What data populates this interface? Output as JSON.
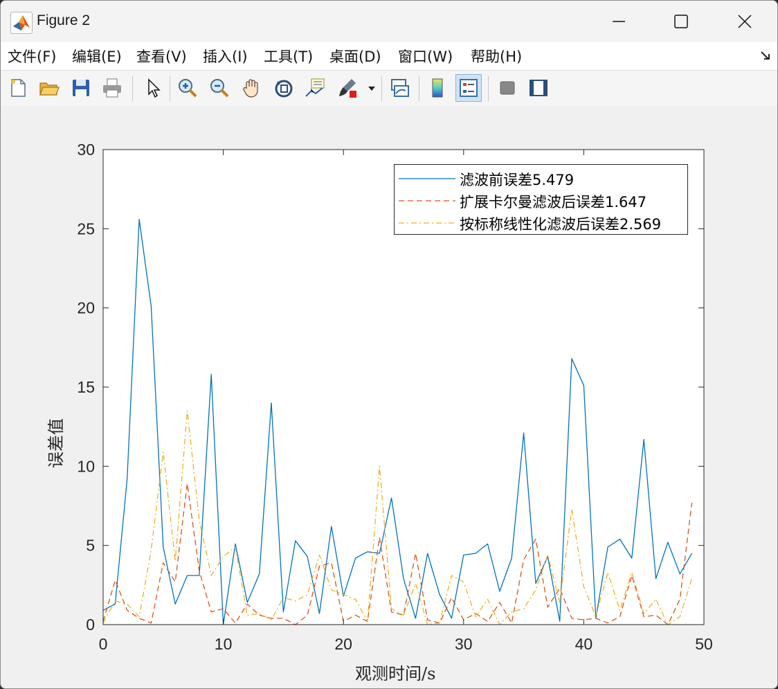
{
  "window": {
    "title": "Figure 2"
  },
  "menu": {
    "items": [
      {
        "label": "文件(F)"
      },
      {
        "label": "编辑(E)"
      },
      {
        "label": "查看(V)"
      },
      {
        "label": "插入(I)"
      },
      {
        "label": "工具(T)"
      },
      {
        "label": "桌面(D)"
      },
      {
        "label": "窗口(W)"
      },
      {
        "label": "帮助(H)"
      }
    ]
  },
  "toolbar": {
    "icons": [
      "new-figure-icon",
      "open-folder-icon",
      "save-icon",
      "print-icon",
      "pointer-icon",
      "zoom-in-icon",
      "zoom-out-icon",
      "pan-hand-icon",
      "rotate-3d-icon",
      "data-cursor-icon",
      "brush-icon",
      "dropdown-arrow-icon",
      "link-plot-icon",
      "colorbar-icon",
      "legend-icon",
      "hide-plot-tools-icon",
      "show-plot-tools-icon"
    ]
  },
  "colors": {
    "series1": "#0072BD",
    "series2": "#D95319",
    "series3": "#EDB120",
    "axes": "#262626",
    "plot_bg": "#ffffff"
  },
  "chart_data": {
    "type": "line",
    "title": "",
    "xlabel": "观测时间/s",
    "ylabel": "误差值",
    "xlim": [
      0,
      50
    ],
    "ylim": [
      0,
      30
    ],
    "xticks": [
      0,
      10,
      20,
      30,
      40,
      50
    ],
    "yticks": [
      0,
      5,
      10,
      15,
      20,
      25,
      30
    ],
    "grid": false,
    "legend_position": "top-right",
    "x": [
      0,
      1,
      2,
      3,
      4,
      5,
      6,
      7,
      8,
      9,
      10,
      11,
      12,
      13,
      14,
      15,
      16,
      17,
      18,
      19,
      20,
      21,
      22,
      23,
      24,
      25,
      26,
      27,
      28,
      29,
      30,
      31,
      32,
      33,
      34,
      35,
      36,
      37,
      38,
      39,
      40,
      41,
      42,
      43,
      44,
      45,
      46,
      47,
      48,
      49
    ],
    "series": [
      {
        "name": "滤波前误差5.479",
        "style": "solid",
        "values": [
          0.9,
          1.3,
          9.2,
          25.6,
          20.1,
          4.9,
          1.3,
          3.1,
          3.1,
          15.8,
          0.0,
          5.1,
          1.4,
          3.2,
          14.0,
          0.8,
          5.3,
          4.3,
          0.7,
          6.2,
          1.8,
          4.2,
          4.6,
          4.5,
          8.0,
          2.9,
          0.4,
          4.5,
          1.9,
          0.4,
          4.4,
          4.5,
          5.1,
          2.1,
          4.2,
          12.1,
          2.6,
          4.3,
          0.2,
          16.8,
          15.1,
          0.4,
          4.9,
          5.4,
          4.2,
          11.7,
          2.9,
          5.2,
          3.2,
          4.5
        ]
      },
      {
        "name": "扩展卡尔曼滤波后误差1.647",
        "style": "dashed",
        "values": [
          0.2,
          2.8,
          0.9,
          0.4,
          0.1,
          3.9,
          2.7,
          8.9,
          3.4,
          0.8,
          1.0,
          0.1,
          1.3,
          0.6,
          0.4,
          0.4,
          0.0,
          0.6,
          3.7,
          3.9,
          0.2,
          0.6,
          0.2,
          5.5,
          0.8,
          0.6,
          4.5,
          0.3,
          0.1,
          1.7,
          0.3,
          0.7,
          0.2,
          1.4,
          0.1,
          4.1,
          5.4,
          1.1,
          2.3,
          0.4,
          0.3,
          0.4,
          0.1,
          0.5,
          3.1,
          0.5,
          0.6,
          0.0,
          1.6,
          7.7
        ]
      },
      {
        "name": "按标称线性化滤波后误差2.569",
        "style": "dashdot",
        "values": [
          0.1,
          1.5,
          1.3,
          0.5,
          4.7,
          10.9,
          4.0,
          13.5,
          6.6,
          3.1,
          4.3,
          4.9,
          0.6,
          0.7,
          0.3,
          1.7,
          1.5,
          1.9,
          4.4,
          2.2,
          1.9,
          1.6,
          0.2,
          10.0,
          1.0,
          0.6,
          2.6,
          0.0,
          0.1,
          3.1,
          2.7,
          0.5,
          1.6,
          0.0,
          0.8,
          1.0,
          2.2,
          4.4,
          1.4,
          7.3,
          2.4,
          0.5,
          3.3,
          0.9,
          3.3,
          0.7,
          1.6,
          0.0,
          0.5,
          2.9
        ]
      }
    ]
  }
}
